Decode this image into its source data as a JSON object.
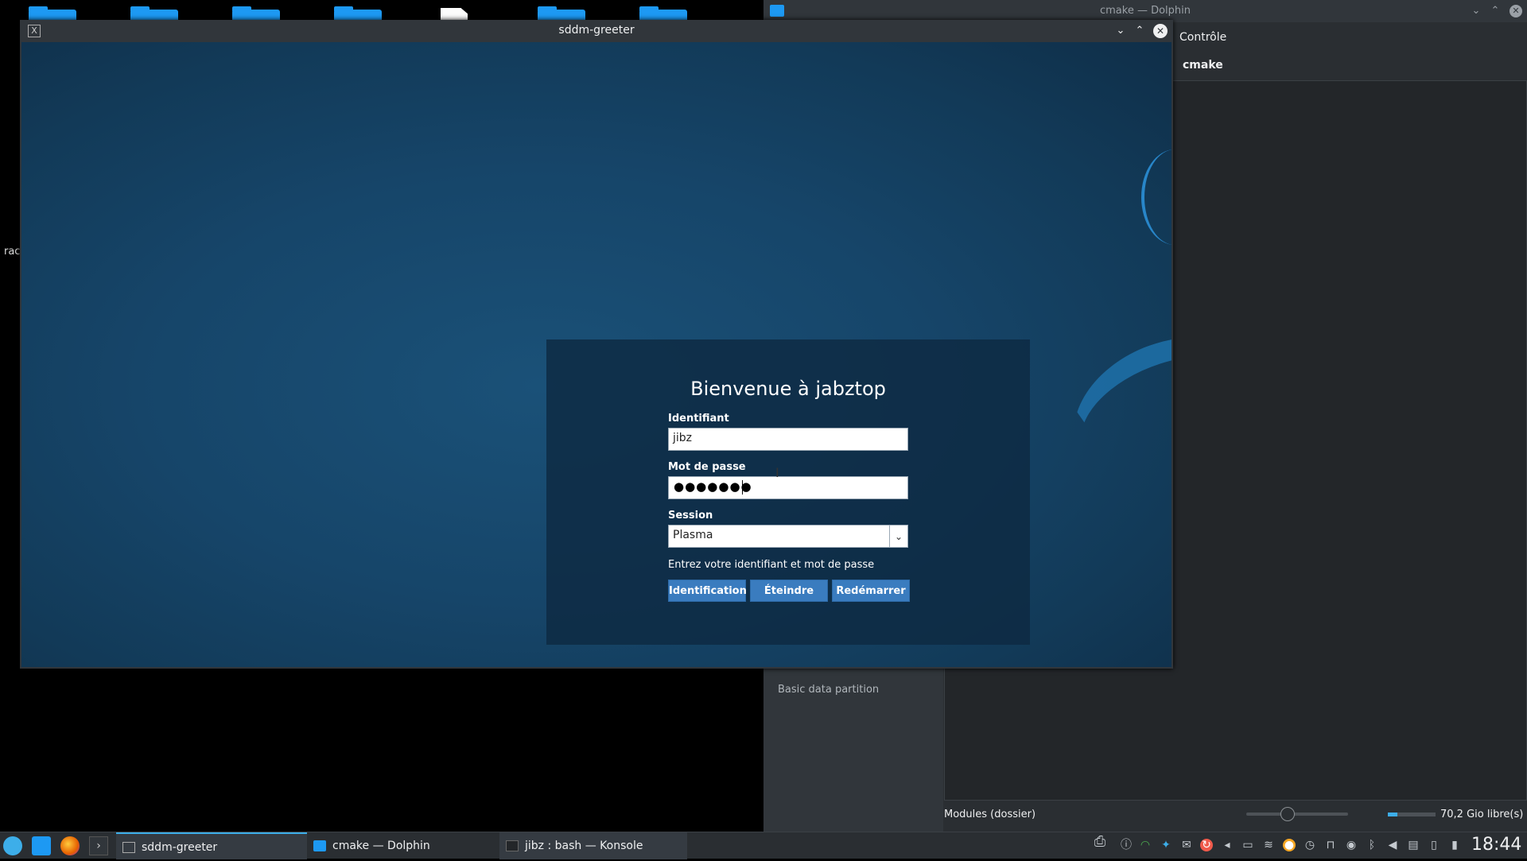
{
  "desktop": {
    "partial_label": "rac"
  },
  "dolphin": {
    "window_title": "cmake — Dolphin",
    "menu_label": "Contrôle",
    "breadcrumb": "cmake",
    "places_partial_item": "Basic data partition",
    "status_text": "Modules (dossier)",
    "free_space": "70,2 Gio libre(s)"
  },
  "greeter": {
    "window_title": "sddm-greeter",
    "welcome": "Bienvenue à jabztop",
    "username_label": "Identifiant",
    "username_value": "jibz",
    "password_label": "Mot de passe",
    "password_mask": "●●●●●●●",
    "session_label": "Session",
    "session_value": "Plasma",
    "hint": "Entrez votre identifiant et mot de passe",
    "buttons": {
      "login": "Identification",
      "shutdown": "Éteindre",
      "reboot": "Redémarrer"
    }
  },
  "taskbar": {
    "tasks": [
      {
        "label": "sddm-greeter"
      },
      {
        "label": "cmake — Dolphin"
      },
      {
        "label": "jibz : bash — Konsole"
      }
    ],
    "clock": "18:44"
  },
  "colors": {
    "accent": "#3daee9",
    "button": "#3a7cbf",
    "greeter_bg": "#164569"
  }
}
